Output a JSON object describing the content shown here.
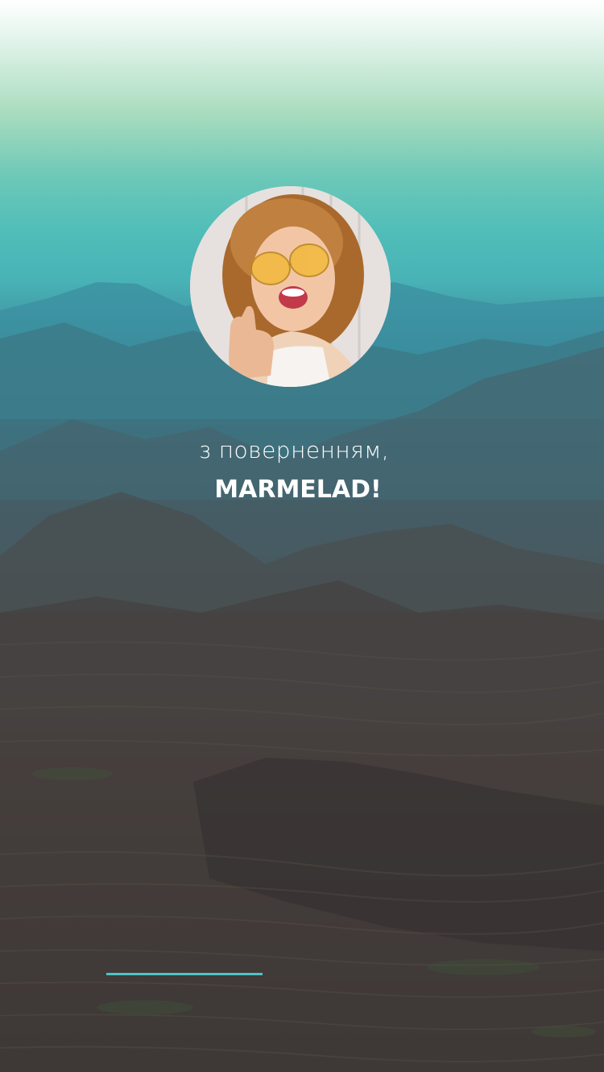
{
  "welcome": {
    "greeting": "з поверненням,",
    "username": "MARMELAD!"
  },
  "avatar": {
    "icon": "user-photo"
  },
  "loading": {
    "progress": 1.0
  },
  "colors": {
    "accent": "#4fc3c3",
    "text": "#ffffff"
  }
}
